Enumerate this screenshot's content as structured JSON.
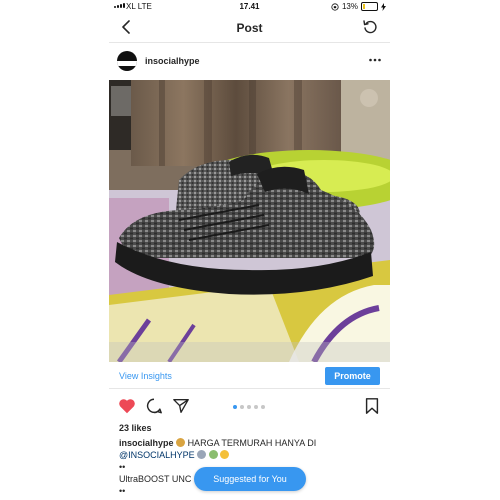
{
  "status_bar": {
    "carrier": "XL  LTE",
    "time": "17.41",
    "battery": "13%",
    "battery_level": 0.13
  },
  "nav": {
    "title": "Post",
    "back_icon": "chevron-left-icon",
    "refresh_icon": "refresh-icon"
  },
  "post": {
    "username": "insocialhype",
    "more_icon": "more-horizontal-icon",
    "insights_label": "View Insights",
    "promote_label": "Promote",
    "likes": "23 likes",
    "caption": {
      "user": "insocialhype",
      "line1": "HARGA TERMURAH HANYA DI",
      "mention": "@INSOCIALHYPE",
      "dots1": "••",
      "line3": "UltraBOOST UNC",
      "dots2": "••"
    },
    "carousel": {
      "count": 5,
      "active": 1
    }
  },
  "floating": {
    "suggested_label": "Suggested for You"
  },
  "colors": {
    "accent": "#3897f0",
    "heart": "#ed4956",
    "battery": "#e9c21b"
  }
}
